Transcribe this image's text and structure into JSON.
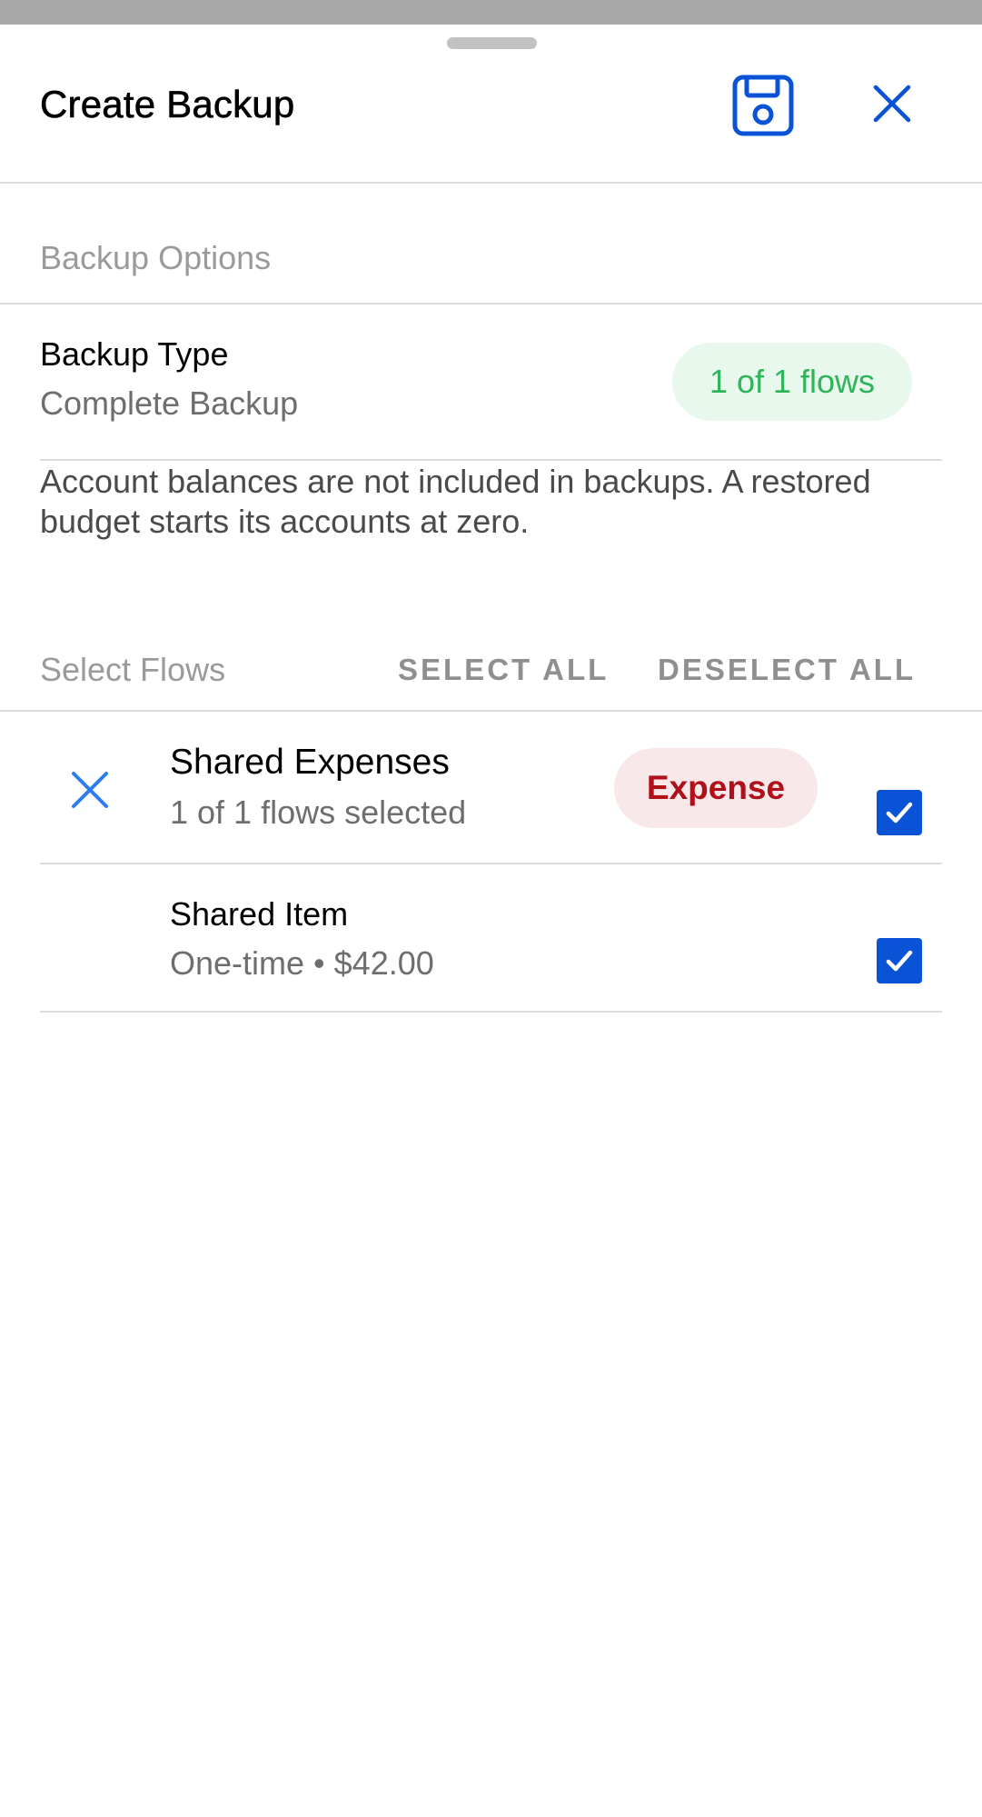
{
  "header": {
    "title": "Create Backup",
    "save_icon": "save-icon",
    "close_icon": "close-icon"
  },
  "backup_options": {
    "section_label": "Backup Options",
    "type_title": "Backup Type",
    "type_value": "Complete Backup",
    "flows_badge": "1 of 1 flows",
    "note": "Account balances are not included in backups. A restored budget starts its accounts at zero."
  },
  "select_flows": {
    "section_label": "Select Flows",
    "select_all": "SELECT ALL",
    "deselect_all": "DESELECT ALL"
  },
  "groups": [
    {
      "title": "Shared Expenses",
      "subtitle": "1 of 1 flows selected",
      "badge": "Expense",
      "checked": true,
      "icon": "collapse-x-icon"
    }
  ],
  "items": [
    {
      "title": "Shared Item",
      "subtitle": "One-time • $42.00",
      "checked": true
    }
  ],
  "colors": {
    "accent_blue": "#0a52d6",
    "badge_green_text": "#2fb45a",
    "badge_green_bg": "#e8f8ec",
    "badge_red_text": "#b0101a",
    "badge_red_bg": "#f8e8ea"
  }
}
